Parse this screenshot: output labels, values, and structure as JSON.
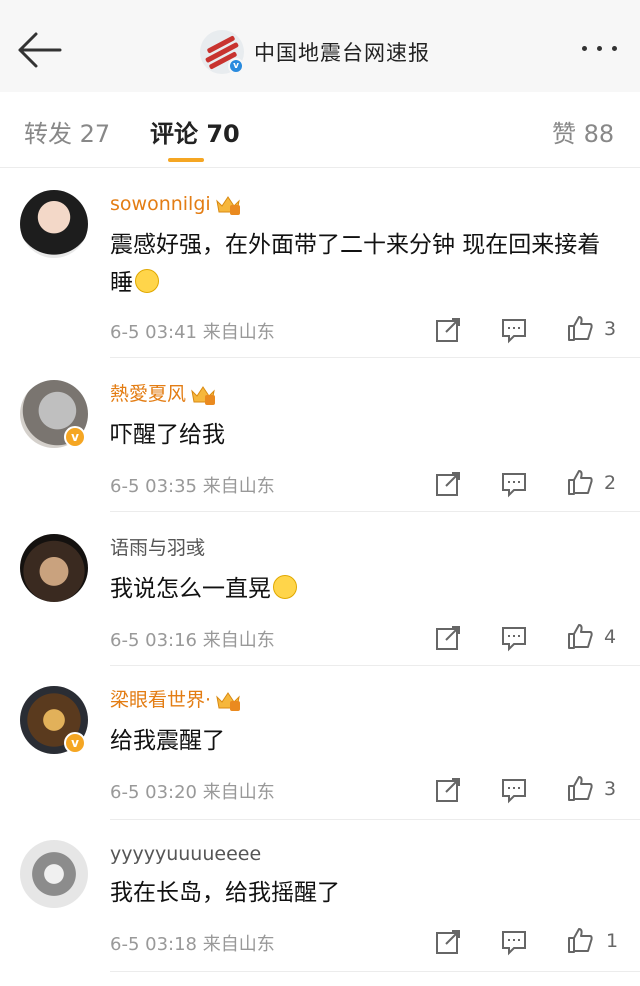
{
  "header": {
    "title": "中国地震台网速报",
    "verified_badge": "v"
  },
  "tabs": {
    "repost": "转发 27",
    "comments": "评论 70",
    "likes": "赞 88"
  },
  "comments": [
    {
      "user": "sowonnilgi",
      "text": "震感好强，在外面带了二十来分钟 现在回来接着睡",
      "time": "6-5 03:41",
      "source": "来自山东",
      "likes": "3"
    },
    {
      "user": "熱愛夏风",
      "text": "吓醒了给我",
      "time": "6-5 03:35",
      "source": "来自山东",
      "likes": "2"
    },
    {
      "user": "语雨与羽彧",
      "text": "我说怎么一直晃",
      "time": "6-5 03:16",
      "source": "来自山东",
      "likes": "4"
    },
    {
      "user": "梁眼看世界·",
      "text": "给我震醒了",
      "time": "6-5 03:20",
      "source": "来自山东",
      "likes": "3"
    },
    {
      "user": "yyyyyuuuueeee",
      "text": "我在长岛，给我摇醒了",
      "time": "6-5 03:18",
      "source": "来自山东",
      "likes": "1"
    }
  ],
  "colors": {
    "vip_name": "#e37d14",
    "tab_indicator": "#f5a623",
    "verified_blue": "#2a8bde"
  }
}
